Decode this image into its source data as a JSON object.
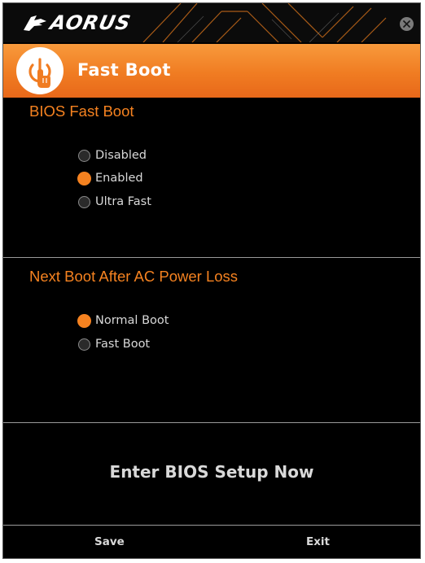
{
  "app": {
    "brand": "AORUS",
    "brand_icon": "aorus-eagle-logo",
    "close_icon": "close-icon"
  },
  "header": {
    "title": "Fast Boot",
    "icon": "power-touch-icon"
  },
  "bios_fast_boot": {
    "title": "BIOS Fast Boot",
    "options": [
      {
        "label": "Disabled",
        "selected": false
      },
      {
        "label": "Enabled",
        "selected": true
      },
      {
        "label": "Ultra Fast",
        "selected": false
      }
    ]
  },
  "next_boot": {
    "title": "Next Boot After AC Power Loss",
    "options": [
      {
        "label": "Normal Boot",
        "selected": true
      },
      {
        "label": "Fast Boot",
        "selected": false
      }
    ]
  },
  "actions": {
    "enter_bios": "Enter BIOS Setup Now",
    "save": "Save",
    "exit": "Exit"
  },
  "colors": {
    "accent": "#f58220",
    "background": "#000000",
    "text": "#d9d9d9"
  }
}
